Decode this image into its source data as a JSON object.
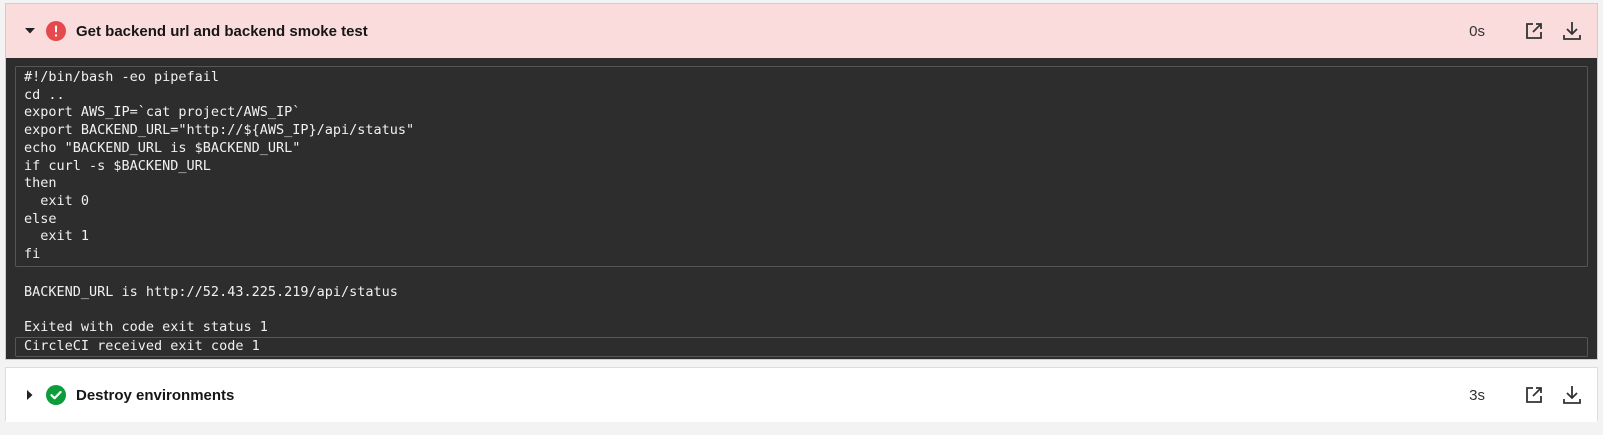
{
  "steps": [
    {
      "title": "Get backend url and backend smoke test",
      "duration": "0s",
      "status": "failed",
      "status_color": "#e5484d",
      "icon": "error-icon"
    },
    {
      "title": "Destroy environments",
      "duration": "3s",
      "status": "success",
      "status_color": "#0c9c3a",
      "icon": "check-circle-icon"
    }
  ],
  "script_lines": [
    "#!/bin/bash -eo pipefail",
    "cd ..",
    "export AWS_IP=`cat project/AWS_IP`",
    "export BACKEND_URL=\"http://${AWS_IP}/api/status\"",
    "echo \"BACKEND_URL is $BACKEND_URL\"",
    "if curl -s $BACKEND_URL",
    "then",
    "  exit 0",
    "else",
    "  exit 1",
    "fi"
  ],
  "output": {
    "line1": "BACKEND_URL is http://52.43.225.219/api/status",
    "line2": "Exited with code exit status 1",
    "line3": "CircleCI received exit code 1"
  },
  "colors": {
    "failed_header_bg": "#fbdcdc",
    "log_bg": "#2d2d2d"
  }
}
